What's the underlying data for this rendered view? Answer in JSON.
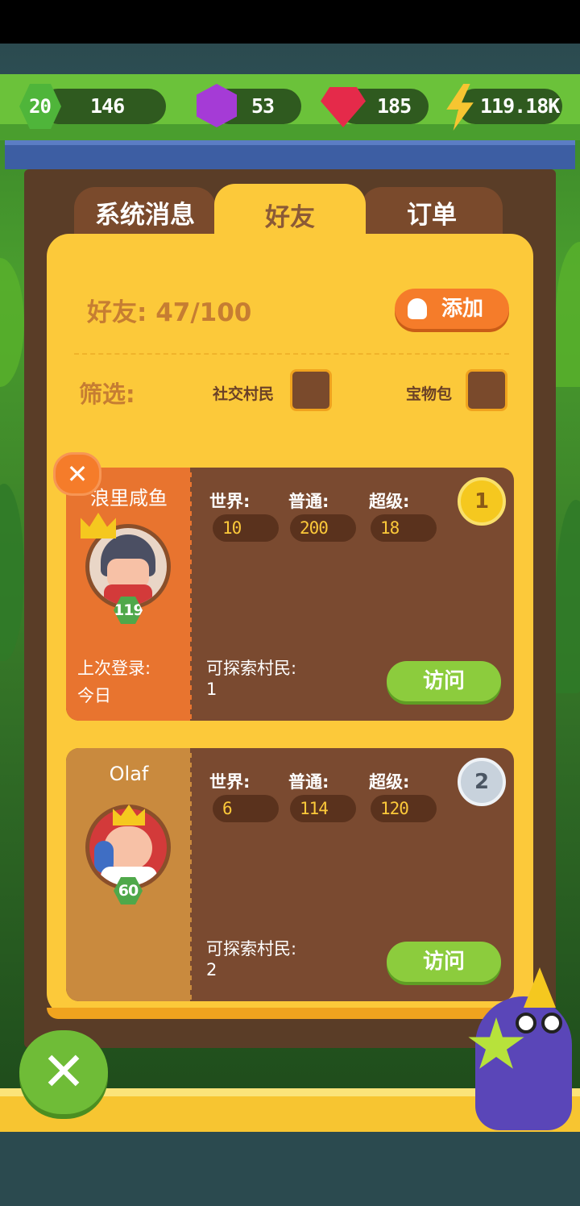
{
  "resources": {
    "level": "20",
    "xp": "146",
    "purple_gems": "53",
    "red_gems": "185",
    "energy": "119.18K"
  },
  "tabs": [
    {
      "label": "系统消息",
      "active": false
    },
    {
      "label": "好友",
      "active": true
    },
    {
      "label": "订单",
      "active": false
    }
  ],
  "friends_header": {
    "count_label": "好友: 47/100",
    "add_label": "添加"
  },
  "filter": {
    "label": "筛选:",
    "option1": "社交村民",
    "option2": "宝物包"
  },
  "friends": [
    {
      "name": "浪里咸鱼",
      "level": "119",
      "rank": "1",
      "last_login_label": "上次登录:",
      "last_login_value": "今日",
      "world_label": "世界:",
      "normal_label": "普通:",
      "super_label": "超级:",
      "world": "10",
      "normal": "200",
      "super": "18",
      "explore_label": "可探索村民:",
      "explore_value": "1",
      "visit_label": "访问"
    },
    {
      "name": "Olaf",
      "level": "60",
      "rank": "2",
      "world_label": "世界:",
      "normal_label": "普通:",
      "super_label": "超级:",
      "world": "6",
      "normal": "114",
      "super": "120",
      "explore_label": "可探索村民:",
      "explore_value": "2",
      "visit_label": "访问"
    }
  ],
  "remove_icon": "close-icon",
  "close_icon": "close-icon"
}
